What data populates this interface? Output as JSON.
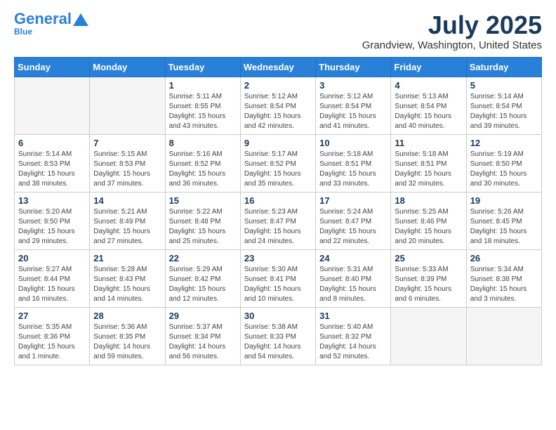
{
  "header": {
    "logo_general": "General",
    "logo_blue": "Blue",
    "month_title": "July 2025",
    "location": "Grandview, Washington, United States"
  },
  "days_of_week": [
    "Sunday",
    "Monday",
    "Tuesday",
    "Wednesday",
    "Thursday",
    "Friday",
    "Saturday"
  ],
  "weeks": [
    [
      {
        "day": "",
        "content": ""
      },
      {
        "day": "",
        "content": ""
      },
      {
        "day": "1",
        "content": "Sunrise: 5:11 AM\nSunset: 8:55 PM\nDaylight: 15 hours and 43 minutes."
      },
      {
        "day": "2",
        "content": "Sunrise: 5:12 AM\nSunset: 8:54 PM\nDaylight: 15 hours and 42 minutes."
      },
      {
        "day": "3",
        "content": "Sunrise: 5:12 AM\nSunset: 8:54 PM\nDaylight: 15 hours and 41 minutes."
      },
      {
        "day": "4",
        "content": "Sunrise: 5:13 AM\nSunset: 8:54 PM\nDaylight: 15 hours and 40 minutes."
      },
      {
        "day": "5",
        "content": "Sunrise: 5:14 AM\nSunset: 8:54 PM\nDaylight: 15 hours and 39 minutes."
      }
    ],
    [
      {
        "day": "6",
        "content": "Sunrise: 5:14 AM\nSunset: 8:53 PM\nDaylight: 15 hours and 38 minutes."
      },
      {
        "day": "7",
        "content": "Sunrise: 5:15 AM\nSunset: 8:53 PM\nDaylight: 15 hours and 37 minutes."
      },
      {
        "day": "8",
        "content": "Sunrise: 5:16 AM\nSunset: 8:52 PM\nDaylight: 15 hours and 36 minutes."
      },
      {
        "day": "9",
        "content": "Sunrise: 5:17 AM\nSunset: 8:52 PM\nDaylight: 15 hours and 35 minutes."
      },
      {
        "day": "10",
        "content": "Sunrise: 5:18 AM\nSunset: 8:51 PM\nDaylight: 15 hours and 33 minutes."
      },
      {
        "day": "11",
        "content": "Sunrise: 5:18 AM\nSunset: 8:51 PM\nDaylight: 15 hours and 32 minutes."
      },
      {
        "day": "12",
        "content": "Sunrise: 5:19 AM\nSunset: 8:50 PM\nDaylight: 15 hours and 30 minutes."
      }
    ],
    [
      {
        "day": "13",
        "content": "Sunrise: 5:20 AM\nSunset: 8:50 PM\nDaylight: 15 hours and 29 minutes."
      },
      {
        "day": "14",
        "content": "Sunrise: 5:21 AM\nSunset: 8:49 PM\nDaylight: 15 hours and 27 minutes."
      },
      {
        "day": "15",
        "content": "Sunrise: 5:22 AM\nSunset: 8:48 PM\nDaylight: 15 hours and 25 minutes."
      },
      {
        "day": "16",
        "content": "Sunrise: 5:23 AM\nSunset: 8:47 PM\nDaylight: 15 hours and 24 minutes."
      },
      {
        "day": "17",
        "content": "Sunrise: 5:24 AM\nSunset: 8:47 PM\nDaylight: 15 hours and 22 minutes."
      },
      {
        "day": "18",
        "content": "Sunrise: 5:25 AM\nSunset: 8:46 PM\nDaylight: 15 hours and 20 minutes."
      },
      {
        "day": "19",
        "content": "Sunrise: 5:26 AM\nSunset: 8:45 PM\nDaylight: 15 hours and 18 minutes."
      }
    ],
    [
      {
        "day": "20",
        "content": "Sunrise: 5:27 AM\nSunset: 8:44 PM\nDaylight: 15 hours and 16 minutes."
      },
      {
        "day": "21",
        "content": "Sunrise: 5:28 AM\nSunset: 8:43 PM\nDaylight: 15 hours and 14 minutes."
      },
      {
        "day": "22",
        "content": "Sunrise: 5:29 AM\nSunset: 8:42 PM\nDaylight: 15 hours and 12 minutes."
      },
      {
        "day": "23",
        "content": "Sunrise: 5:30 AM\nSunset: 8:41 PM\nDaylight: 15 hours and 10 minutes."
      },
      {
        "day": "24",
        "content": "Sunrise: 5:31 AM\nSunset: 8:40 PM\nDaylight: 15 hours and 8 minutes."
      },
      {
        "day": "25",
        "content": "Sunrise: 5:33 AM\nSunset: 8:39 PM\nDaylight: 15 hours and 6 minutes."
      },
      {
        "day": "26",
        "content": "Sunrise: 5:34 AM\nSunset: 8:38 PM\nDaylight: 15 hours and 3 minutes."
      }
    ],
    [
      {
        "day": "27",
        "content": "Sunrise: 5:35 AM\nSunset: 8:36 PM\nDaylight: 15 hours and 1 minute."
      },
      {
        "day": "28",
        "content": "Sunrise: 5:36 AM\nSunset: 8:35 PM\nDaylight: 14 hours and 59 minutes."
      },
      {
        "day": "29",
        "content": "Sunrise: 5:37 AM\nSunset: 8:34 PM\nDaylight: 14 hours and 56 minutes."
      },
      {
        "day": "30",
        "content": "Sunrise: 5:38 AM\nSunset: 8:33 PM\nDaylight: 14 hours and 54 minutes."
      },
      {
        "day": "31",
        "content": "Sunrise: 5:40 AM\nSunset: 8:32 PM\nDaylight: 14 hours and 52 minutes."
      },
      {
        "day": "",
        "content": ""
      },
      {
        "day": "",
        "content": ""
      }
    ]
  ]
}
